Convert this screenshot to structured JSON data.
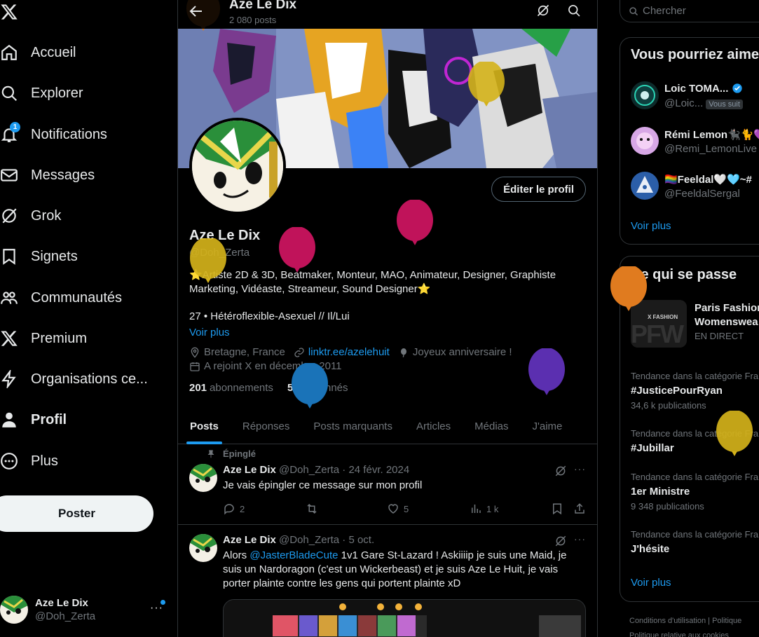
{
  "nav": {
    "items": [
      {
        "label": "Accueil",
        "icon": "home-icon"
      },
      {
        "label": "Explorer",
        "icon": "search-icon"
      },
      {
        "label": "Notifications",
        "icon": "bell-icon",
        "badge": "1"
      },
      {
        "label": "Messages",
        "icon": "mail-icon"
      },
      {
        "label": "Grok",
        "icon": "grok-icon"
      },
      {
        "label": "Signets",
        "icon": "bookmark-icon"
      },
      {
        "label": "Communautés",
        "icon": "communities-icon"
      },
      {
        "label": "Premium",
        "icon": "x-logo-icon"
      },
      {
        "label": "Organisations ce...",
        "icon": "lightning-icon"
      },
      {
        "label": "Profil",
        "icon": "person-icon"
      },
      {
        "label": "Plus",
        "icon": "more-circle-icon"
      }
    ],
    "post_button": "Poster",
    "account": {
      "name": "Aze Le Dix",
      "handle": "@Doh_Zerta",
      "more": "···"
    }
  },
  "header": {
    "title": "Aze Le Dix",
    "posts_count": "2 080 posts"
  },
  "profile": {
    "edit_button": "Éditer le profil",
    "name": "Aze Le Dix",
    "handle": "@Doh_Zerta",
    "bio": "⭐Artiste 2D & 3D, Beatmaker, Monteur, MAO, Animateur, Designer, Graphiste Marketing, Vidéaste, Streameur, Sound Designer⭐",
    "bio2": "27 • Hétéroflexible-Asexuel // Il/Lui",
    "voir_plus": "Voir plus",
    "location": "Bretagne, France",
    "link": "linktr.ee/azelehuit",
    "birthday": "Joyeux anniversaire !",
    "joined": "A rejoint X en décembre 2011",
    "following_count": "201",
    "following_label": "abonnements",
    "followers_count": "549",
    "followers_label": "abonnés"
  },
  "tabs": [
    "Posts",
    "Réponses",
    "Posts marquants",
    "Articles",
    "Médias",
    "J'aime"
  ],
  "tweets": [
    {
      "pinned_label": "Épinglé",
      "name": "Aze Le Dix",
      "meta": "@Doh_Zerta · 24 févr. 2024",
      "text": "Je vais épingler ce message sur mon profil",
      "replies": "2",
      "retweets": "",
      "likes": "5",
      "views": "1 k"
    },
    {
      "name": "Aze Le Dix",
      "meta": "@Doh_Zerta · 5 oct.",
      "text_pre": "Alors ",
      "mention": "@JasterBladeCute",
      "text_post": " 1v1 Gare St-Lazard ! Askiiiip je suis une Maid, je suis un Nardoragon (c'est un Wickerbeast) et je suis Aze Le Huit, je vais porter plainte contre les gens qui portent plainte xD"
    }
  ],
  "right": {
    "search_placeholder": "Chercher",
    "suggestions_title": "Vous pourriez aime",
    "suggestions": [
      {
        "name": "Loic TOMA...",
        "handle": "@Loic...",
        "follows_you": "Vous suit",
        "verified": true
      },
      {
        "name": "Rémi Lemon🐈‍⬛🐈💜",
        "handle": "@Remi_LemonLive"
      },
      {
        "name": "🏳️‍🌈Feeldal🤍🩵~#",
        "handle": "@FeeldalSergal"
      }
    ],
    "suggestions_more": "Voir plus",
    "trends_title": "Ce qui se passe",
    "featured": {
      "title_line1": "Paris Fashion",
      "title_line2": "Womenswea",
      "status": "EN DIRECT",
      "thumb_label": "X FASHION",
      "thumb_big": "PFW"
    },
    "trends": [
      {
        "category": "Tendance dans la catégorie Fra",
        "title": "#JusticePourRyan",
        "count": "34,6 k publications"
      },
      {
        "category": "Tendance dans la catégorie Fra",
        "title": "#Jubillar",
        "count": ""
      },
      {
        "category": "Tendance dans la catégorie Fra",
        "title": "1er Ministre",
        "count": "9 348 publications"
      },
      {
        "category": "Tendance dans la catégorie Fra",
        "title": "J'hésite",
        "count": ""
      }
    ],
    "trends_more": "Voir plus",
    "footer": "Conditions d'utilisation  |  Politique",
    "footer2": "Politique relative aux cookies"
  },
  "colors": {
    "accent": "#1d9bf0",
    "bg": "#000000",
    "border": "#2f3336",
    "muted": "#71767b"
  }
}
